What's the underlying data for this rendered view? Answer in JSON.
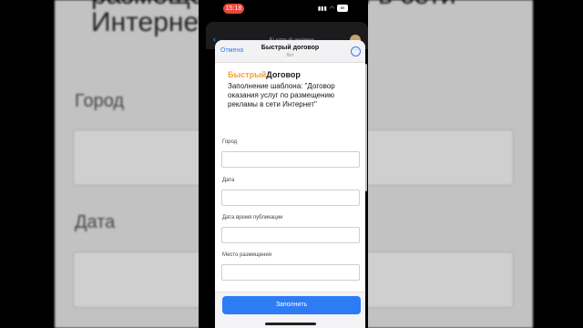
{
  "background": {
    "title": "размещении рекламы в сети Интернет",
    "label_city": "Город",
    "label_date": "Дата"
  },
  "status_bar": {
    "time": "15:18",
    "battery": "89"
  },
  "behind_chat": {
    "title": "Быстрый договор"
  },
  "header": {
    "cancel_label": "Отмена",
    "title": "Быстрый договор",
    "subtitle": "бот"
  },
  "form": {
    "brand_part1": "Быстрый",
    "brand_part2": "Договор",
    "heading": "Заполнение шаблона: \"Договор оказания услуг по размещению рекламы в сети Интернет\"",
    "fields": [
      {
        "label": "Город",
        "value": ""
      },
      {
        "label": "Дата",
        "value": ""
      },
      {
        "label": "Дата время публикации",
        "value": ""
      },
      {
        "label": "Место размещения",
        "value": ""
      }
    ],
    "submit_label": "Заполнить"
  },
  "colors": {
    "accent": "#2d7cf6",
    "brand_orange": "#f2a33c",
    "time_pill": "#e8463a"
  }
}
